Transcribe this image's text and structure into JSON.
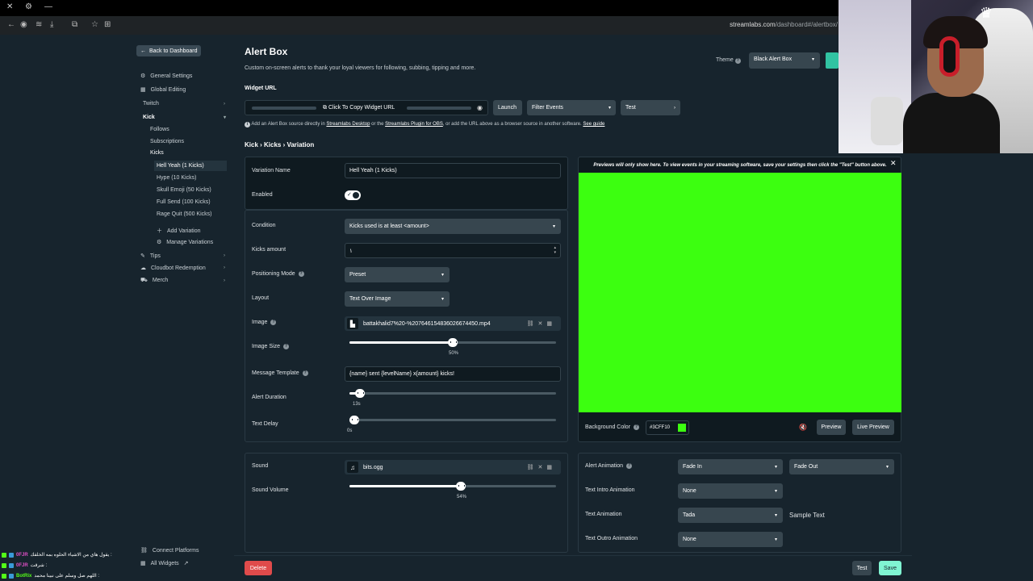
{
  "browser": {
    "url_host": "streamlabs.com",
    "url_path": "/dashboard#/alertbox/"
  },
  "sidebar": {
    "back_label": "Back to Dashboard",
    "items": [
      {
        "label": "General Settings"
      },
      {
        "label": "Global Editing"
      },
      {
        "label": "Twitch"
      },
      {
        "label": "Kick"
      }
    ],
    "kick_sub": [
      "Follows",
      "Subscriptions",
      "Kicks"
    ],
    "variations": [
      "Hell Yeah (1 Kicks)",
      "Hype (10 Kicks)",
      "Skull Emoji (50 Kicks)",
      "Full Send (100 Kicks)",
      "Rage Quit (500 Kicks)"
    ],
    "add_variation": "Add Variation",
    "manage_variations": "Manage Variations",
    "more": [
      "Tips",
      "Cloudbot Redemption",
      "Merch"
    ],
    "connect_platforms": "Connect Platforms",
    "all_widgets": "All Widgets"
  },
  "header": {
    "title": "Alert Box",
    "description": "Custom on-screen alerts to thank your loyal viewers for following, subbing, tipping and more.",
    "theme_label": "Theme",
    "theme_value": "Black Alert Box",
    "widget_url_label": "Widget URL",
    "copy_label": "Click To Copy Widget URL",
    "launch": "Launch",
    "filter_events": "Filter Events",
    "test": "Test",
    "info_pre": "Add an Alert Box source directly in",
    "info_link1": "Streamlabs Desktop",
    "info_mid": "or the",
    "info_link2": "Streamlabs Plugin for OBS",
    "info_post": ", or add the URL above as a browser source in another software.",
    "info_link3": "See guide",
    "breadcrumb": "Kick › Kicks › Variation"
  },
  "form": {
    "variation_name_label": "Variation Name",
    "variation_name_value": "Hell Yeah (1 Kicks)",
    "enabled_label": "Enabled",
    "condition_label": "Condition",
    "condition_value": "Kicks used is at least <amount>",
    "kicks_amount_label": "Kicks amount",
    "kicks_amount_value": "١",
    "positioning_label": "Positioning Mode",
    "positioning_value": "Preset",
    "layout_label": "Layout",
    "layout_value": "Text Over Image",
    "image_label": "Image",
    "image_file": "battakhalid7%20-%2076461548360266744​50.mp4",
    "image_size_label": "Image Size",
    "image_size_value": "50%",
    "image_size_fraction": 0.5,
    "message_template_label": "Message Template",
    "message_template_value": "{name} sent {levelName} x{amount} kicks!",
    "alert_duration_label": "Alert Duration",
    "alert_duration_value": "13s",
    "alert_duration_fraction": 0.03,
    "text_delay_label": "Text Delay",
    "text_delay_value": "0s",
    "text_delay_fraction": 0.0,
    "sound_label": "Sound",
    "sound_file": "bits.ogg",
    "sound_volume_label": "Sound Volume",
    "sound_volume_value": "54%",
    "sound_volume_fraction": 0.54
  },
  "preview": {
    "note": "Previews will only show here. To view events in your streaming software, save your settings then click the \"Test\" button above.",
    "background_color_label": "Background Color",
    "background_color": "#3CFF10",
    "preview_btn": "Preview",
    "live_preview_btn": "Live Preview"
  },
  "animation": {
    "alert_animation_label": "Alert Animation",
    "alert_in": "Fade In",
    "alert_out": "Fade Out",
    "text_intro_label": "Text Intro Animation",
    "text_intro_value": "None",
    "text_animation_label": "Text Animation",
    "text_animation_value": "Tada",
    "sample_text": "Sample Text",
    "text_outro_label": "Text Outro Animation",
    "text_outro_value": "None"
  },
  "footer": {
    "delete": "Delete",
    "test": "Test",
    "save": "Save"
  },
  "chat": [
    {
      "name": "0FJR",
      "text": "يقول هاي من الاشياء الحلوه بمه الخلقك :"
    },
    {
      "name": "0FJR",
      "text": "شرقت :"
    },
    {
      "name": "BotRix",
      "text": "اللهم صل وسلم على نبينا محمد :"
    }
  ],
  "colors": {
    "background": "#17242d",
    "accent": "#31c3a2",
    "delete": "#e04b4b",
    "save": "#80f5d2",
    "green_screen": "#3cff10"
  }
}
